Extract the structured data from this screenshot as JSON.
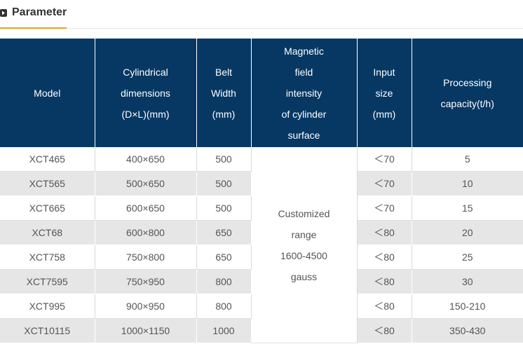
{
  "section": {
    "title": "Parameter"
  },
  "table": {
    "headers": [
      [
        "Model"
      ],
      [
        "Cylindrical",
        "dimensions",
        "(D×L)(mm)"
      ],
      [
        "Belt",
        "Width",
        "(mm)"
      ],
      [
        "Magnetic",
        "field",
        "intensity",
        "of cylinder",
        "surface"
      ],
      [
        "Input",
        "size",
        "(mm)"
      ],
      [
        "Processing",
        "capacity(t/h)"
      ]
    ],
    "rows": [
      {
        "model": "XCT465",
        "dimensions": "400×650",
        "belt_width": "500",
        "input_size": "＜70",
        "capacity": "5"
      },
      {
        "model": "XCT565",
        "dimensions": "500×650",
        "belt_width": "500",
        "input_size": "＜70",
        "capacity": "10"
      },
      {
        "model": "XCT665",
        "dimensions": "600×650",
        "belt_width": "500",
        "input_size": "＜70",
        "capacity": "15"
      },
      {
        "model": "XCT68",
        "dimensions": "600×800",
        "belt_width": "650",
        "input_size": "＜80",
        "capacity": "20"
      },
      {
        "model": "XCT758",
        "dimensions": "750×800",
        "belt_width": "650",
        "input_size": "＜80",
        "capacity": "25"
      },
      {
        "model": "XCT7595",
        "dimensions": "750×950",
        "belt_width": "800",
        "input_size": "＜80",
        "capacity": "30"
      },
      {
        "model": "XCT995",
        "dimensions": "900×950",
        "belt_width": "800",
        "input_size": "＜80",
        "capacity": "150-210"
      },
      {
        "model": "XCT10115",
        "dimensions": "1000×1150",
        "belt_width": "1000",
        "input_size": "＜80",
        "capacity": "350-430"
      }
    ],
    "magnetic_field_merged": [
      "Customized",
      "range",
      "1600-4500",
      "gauss"
    ]
  },
  "colors": {
    "header_bg": "#063863",
    "accent_underline": "#e0a41f",
    "stripe": "#e6e6e6"
  }
}
